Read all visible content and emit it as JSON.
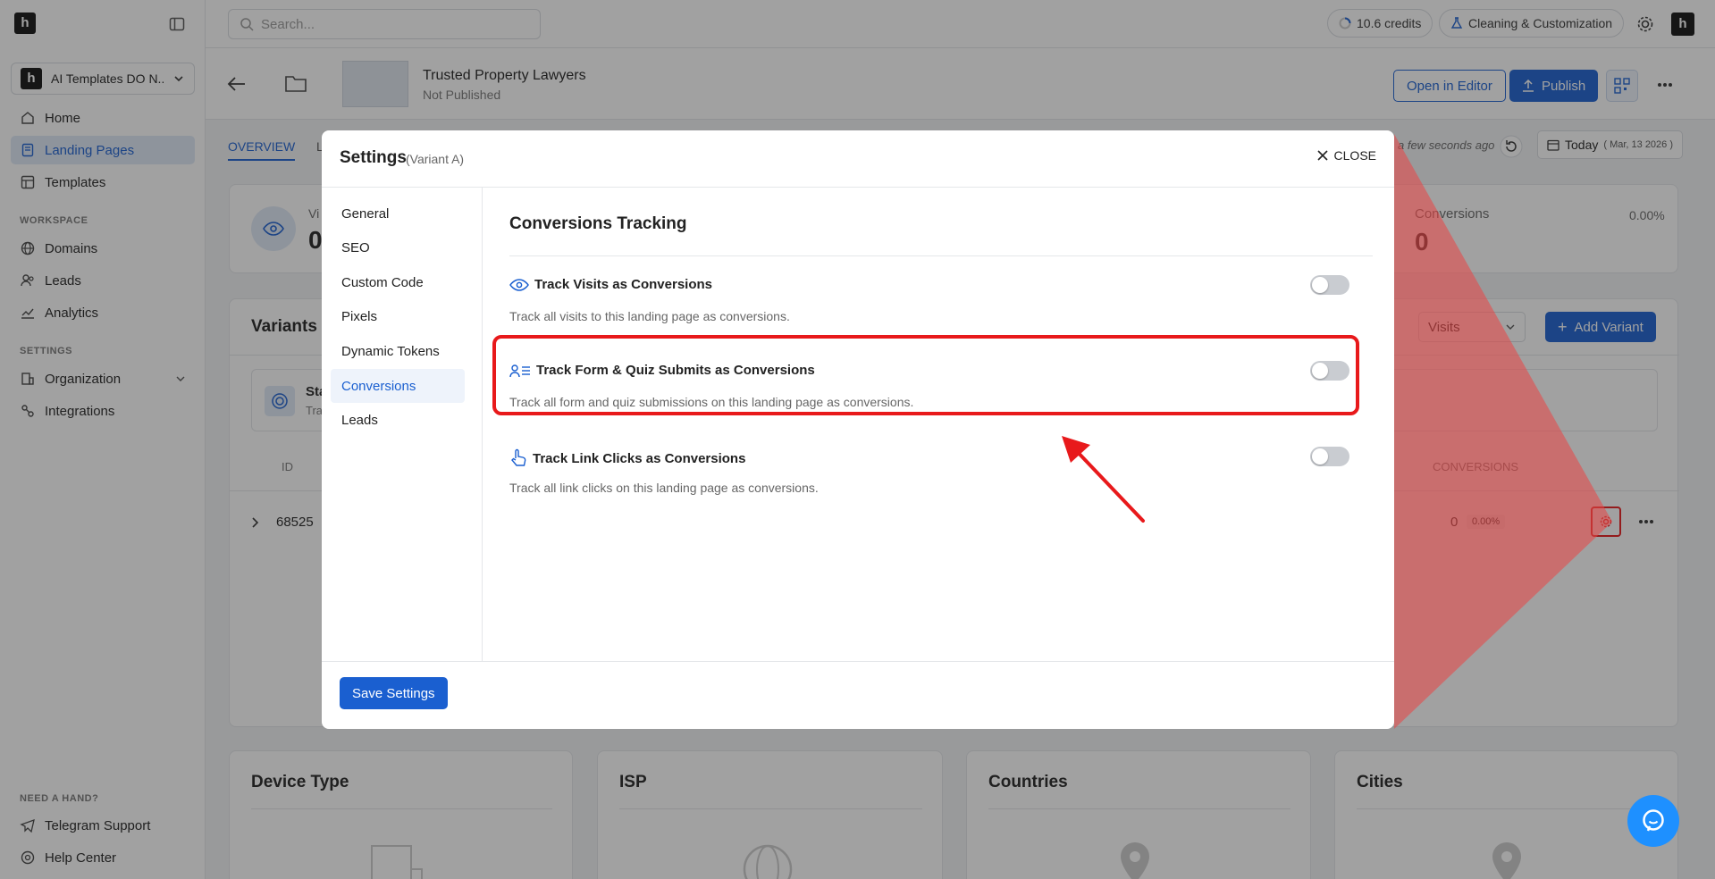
{
  "sidebar": {
    "workspace_name": "AI Templates DO N...",
    "nav": [
      {
        "label": "Home",
        "icon": "home-icon"
      },
      {
        "label": "Landing Pages",
        "icon": "pages-icon"
      },
      {
        "label": "Templates",
        "icon": "templates-icon"
      }
    ],
    "workspace_label": "WORKSPACE",
    "workspace_nav": [
      {
        "label": "Domains",
        "icon": "globe-icon"
      },
      {
        "label": "Leads",
        "icon": "users-icon"
      },
      {
        "label": "Analytics",
        "icon": "chart-icon"
      }
    ],
    "settings_label": "SETTINGS",
    "settings_nav": [
      {
        "label": "Organization",
        "icon": "building-icon"
      },
      {
        "label": "Integrations",
        "icon": "integrations-icon"
      }
    ],
    "help_label": "NEED A HAND?",
    "help_nav": [
      {
        "label": "Telegram Support",
        "icon": "telegram-icon"
      },
      {
        "label": "Help Center",
        "icon": "help-icon"
      }
    ]
  },
  "topbar": {
    "search_placeholder": "Search...",
    "credits": "10.6 credits",
    "cleaning": "Cleaning & Customization"
  },
  "page": {
    "title": "Trusted Property Lawyers",
    "status": "Not Published",
    "open_editor": "Open in Editor",
    "publish": "Publish",
    "tab_overview": "OVERVIEW",
    "tab_partial": "L",
    "updated": "a few seconds ago",
    "date_main": "Today",
    "date_sub": "( Mar, 13 2026 )",
    "stat_left_partial": "Vi",
    "stat_left_value": "0",
    "stat_conv_label": "Conversions",
    "stat_conv_value": "0",
    "stat_conv_pct": "0.00%",
    "variants_title": "Variants",
    "variants_select": "Visits",
    "add_variant": "Add Variant",
    "standard_partial": "Sta",
    "standard_sub_partial": "Tra",
    "col_id": "ID",
    "col_conversions": "CONVERSIONS",
    "row_id": "68525",
    "row_conv": "0",
    "row_pct": "0.00%",
    "cards": [
      "Device Type",
      "ISP",
      "Countries",
      "Cities"
    ]
  },
  "modal": {
    "title": "Settings",
    "subtitle": "(Variant A)",
    "close": "CLOSE",
    "menu": [
      "General",
      "SEO",
      "Custom Code",
      "Pixels",
      "Dynamic Tokens",
      "Conversions",
      "Leads"
    ],
    "active_menu": "Conversions",
    "section_title": "Conversions Tracking",
    "options": [
      {
        "title": "Track Visits as Conversions",
        "desc": "Track all visits to this landing page as conversions.",
        "icon": "eye-icon",
        "enabled": false
      },
      {
        "title": "Track Form & Quiz Submits as Conversions",
        "desc": "Track all form and quiz submissions on this landing page as conversions.",
        "icon": "form-list-icon",
        "enabled": false
      },
      {
        "title": "Track Link Clicks as Conversions",
        "desc": "Track all link clicks on this landing page as conversions.",
        "icon": "pointer-hand-icon",
        "enabled": false
      }
    ],
    "save": "Save Settings"
  },
  "colors": {
    "accent": "#1a5fd0",
    "highlight": "#e8191b"
  }
}
